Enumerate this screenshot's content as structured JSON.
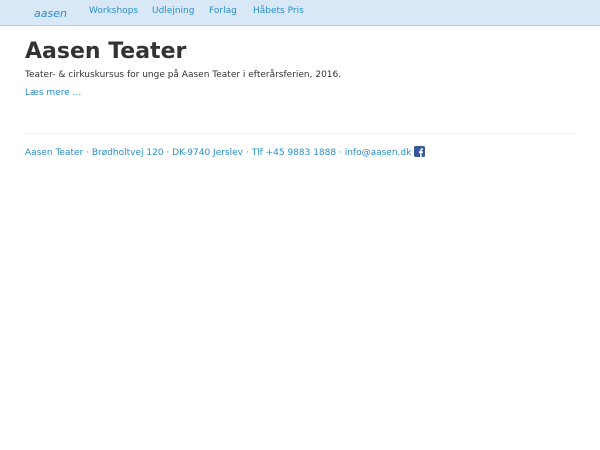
{
  "navbar": {
    "logo_text": "aasen",
    "items": [
      {
        "label": "Workshops"
      },
      {
        "label": "Udlejning"
      },
      {
        "label": "Forlag"
      },
      {
        "label": "Håbets Pris"
      }
    ]
  },
  "main": {
    "title": "Aasen Teater",
    "intro": "Teater- & cirkuskursus for unge på Aasen Teater i efterårsferien, 2016.",
    "read_more": "Læs mere ..."
  },
  "footer": {
    "text": "Aasen Teater · Brødholtvej 120 · DK-9740 Jerslev · Tlf +45 9883 1888 · info@aasen.dk",
    "icon": "facebook-icon"
  },
  "colors": {
    "navbar_bg": "#d9e8f7",
    "link": "#2a8fc8",
    "text": "#333333"
  }
}
